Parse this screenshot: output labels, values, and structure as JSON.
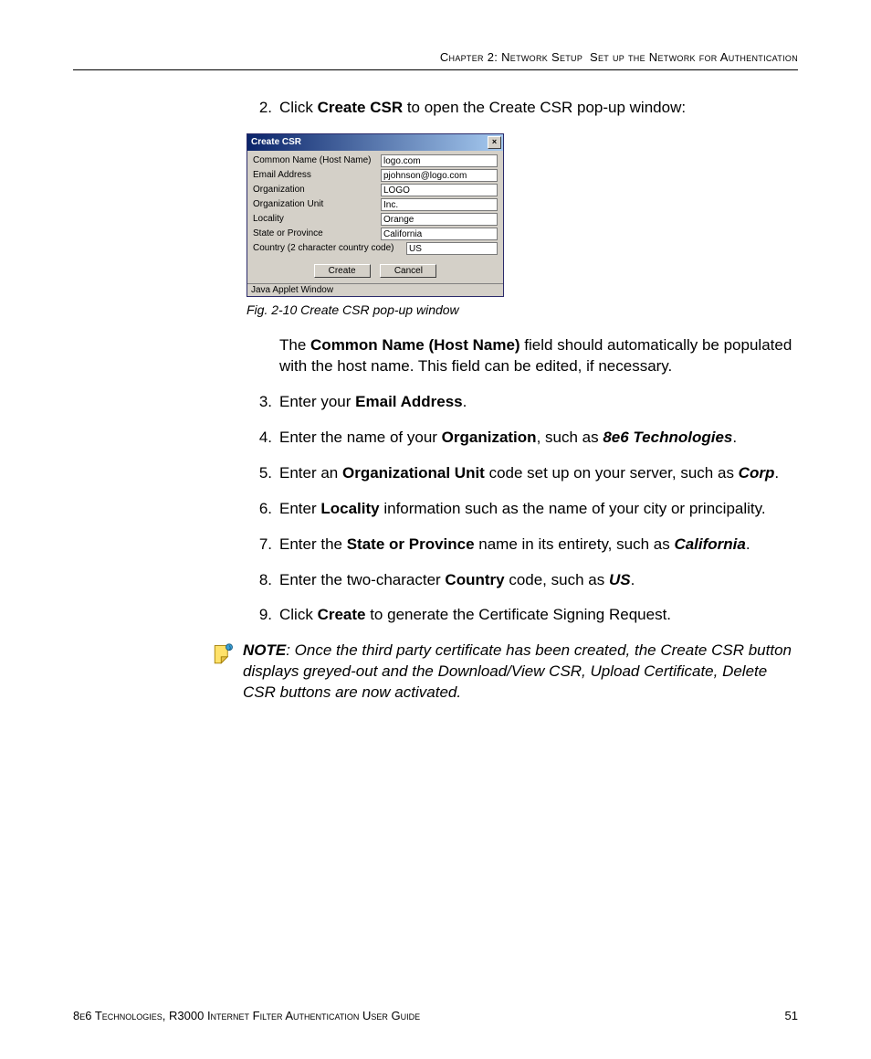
{
  "header": {
    "chapter": "Chapter 2: Network Setup",
    "section": "Set up the Network for Authentication"
  },
  "steps": {
    "s2_num": "2.",
    "s2_a": "Click ",
    "s2_b": "Create CSR",
    "s2_c": " to open the Create CSR pop-up window:",
    "s2_post_a": "The ",
    "s2_post_b": "Common Name (Host Name)",
    "s2_post_c": " field should automatically be populated with the host name. This field can be edited, if necessary.",
    "s3_num": "3.",
    "s3_a": "Enter your ",
    "s3_b": "Email Address",
    "s3_c": ".",
    "s4_num": "4.",
    "s4_a": "Enter the name of your ",
    "s4_b": "Organization",
    "s4_c": ", such as ",
    "s4_d": "8e6 Technologies",
    "s4_e": ".",
    "s5_num": "5.",
    "s5_a": "Enter an ",
    "s5_b": "Organizational Unit",
    "s5_c": " code set up on your server, such as ",
    "s5_d": "Corp",
    "s5_e": ".",
    "s6_num": "6.",
    "s6_a": "Enter ",
    "s6_b": "Locality",
    "s6_c": " information such as the name of your city or principality.",
    "s7_num": "7.",
    "s7_a": "Enter the ",
    "s7_b": "State or Province",
    "s7_c": " name in its entirety, such as ",
    "s7_d": "California",
    "s7_e": ".",
    "s8_num": "8.",
    "s8_a": "Enter the two-character ",
    "s8_b": "Country",
    "s8_c": " code, such as ",
    "s8_d": "US",
    "s8_e": ".",
    "s9_num": "9.",
    "s9_a": "Click ",
    "s9_b": "Create",
    "s9_c": " to generate the Certificate Signing Request."
  },
  "popup": {
    "title": "Create CSR",
    "close": "×",
    "fields": {
      "common_label": "Common Name (Host Name)",
      "common_value": "logo.com",
      "email_label": "Email Address",
      "email_value": "pjohnson@logo.com",
      "org_label": "Organization",
      "org_value": "LOGO",
      "unit_label": "Organization Unit",
      "unit_value": "Inc.",
      "locality_label": "Locality",
      "locality_value": "Orange",
      "state_label": "State or Province",
      "state_value": "California",
      "country_label": "Country (2 character country code)",
      "country_value": "US"
    },
    "buttons": {
      "create": "Create",
      "cancel": "Cancel"
    },
    "status": "Java Applet Window"
  },
  "caption": "Fig. 2-10  Create CSR pop-up window",
  "note": {
    "label": "NOTE",
    "text": ": Once the third party certificate has been created, the Create CSR button displays greyed-out and the Download/View CSR, Upload Certificate, Delete CSR buttons are now activated."
  },
  "footer": {
    "left": "8e6 Technologies, R3000 Internet Filter Authentication User Guide",
    "page": "51"
  }
}
